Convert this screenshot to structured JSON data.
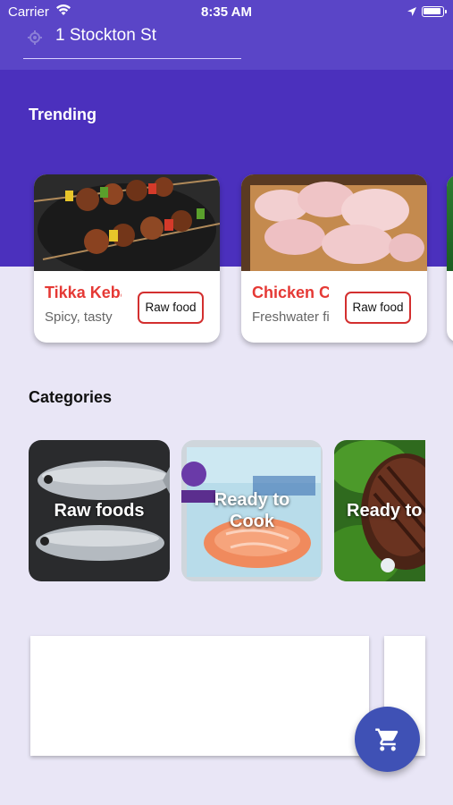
{
  "status_bar": {
    "carrier": "Carrier",
    "time": "8:35 AM"
  },
  "header": {
    "address": "1 Stockton St"
  },
  "trending": {
    "title": "Trending",
    "items": [
      {
        "name": "Tikka Kebab",
        "description": "Spicy, tasty",
        "tag": "Raw food"
      },
      {
        "name": "Chicken Curry",
        "description": "Freshwater fish",
        "tag": "Raw food"
      }
    ]
  },
  "categories": {
    "title": "Categories",
    "items": [
      {
        "label": "Raw foods"
      },
      {
        "label": "Ready to Cook"
      },
      {
        "label": "Ready to Eat"
      }
    ]
  },
  "cart_fab": {
    "icon": "cart-icon"
  },
  "colors": {
    "header_bg": "#5a45c7",
    "hero_bg": "#4b30bd",
    "accent_red": "#e53935",
    "fab_bg": "#3f51b5",
    "page_bg": "#e9e6f6"
  }
}
